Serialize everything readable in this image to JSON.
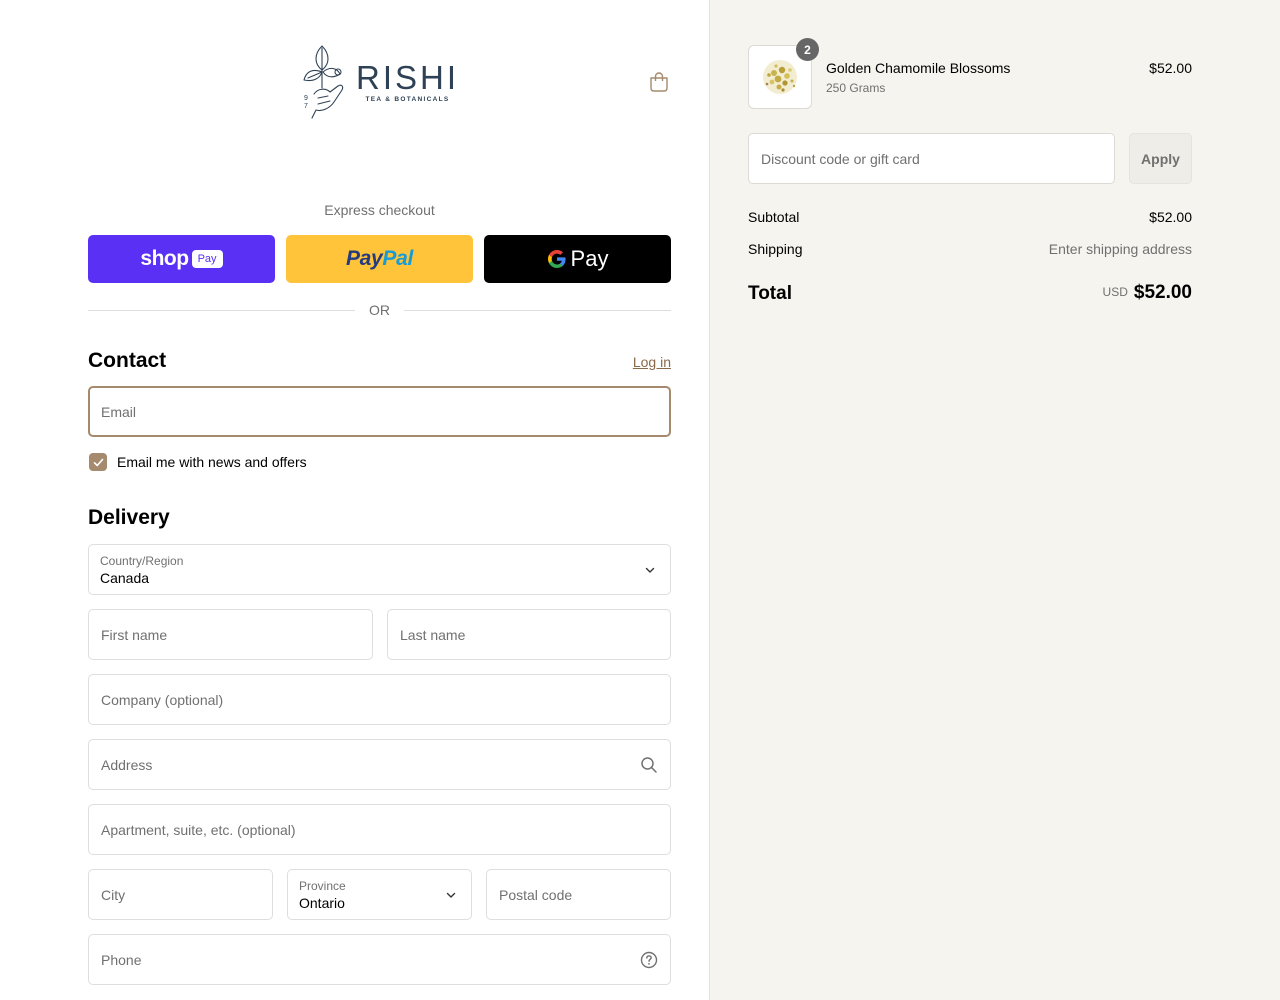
{
  "brand": {
    "name": "RISHI",
    "tagline": "TEA & BOTANICALS",
    "year_digits": "97"
  },
  "express": {
    "title": "Express checkout",
    "shop_pay": {
      "word": "shop",
      "badge": "Pay"
    },
    "paypal": {
      "part1": "Pay",
      "part2": "Pal"
    },
    "google_pay": {
      "word": "Pay"
    },
    "or_label": "OR"
  },
  "contact": {
    "heading": "Contact",
    "login_label": "Log in",
    "email_placeholder": "Email",
    "newsletter_label": "Email me with news and offers",
    "newsletter_checked": true
  },
  "delivery": {
    "heading": "Delivery",
    "country_label": "Country/Region",
    "country_value": "Canada",
    "first_name_placeholder": "First name",
    "last_name_placeholder": "Last name",
    "company_placeholder": "Company (optional)",
    "address_placeholder": "Address",
    "apartment_placeholder": "Apartment, suite, etc. (optional)",
    "city_placeholder": "City",
    "province_label": "Province",
    "province_value": "Ontario",
    "postal_placeholder": "Postal code",
    "phone_placeholder": "Phone"
  },
  "summary": {
    "item": {
      "name": "Golden Chamomile Blossoms",
      "variant": "250 Grams",
      "price": "$52.00",
      "quantity": "2"
    },
    "discount_placeholder": "Discount code or gift card",
    "apply_label": "Apply",
    "subtotal_label": "Subtotal",
    "subtotal_value": "$52.00",
    "shipping_label": "Shipping",
    "shipping_value": "Enter shipping address",
    "total_label": "Total",
    "currency": "USD",
    "total_value": "$52.00"
  },
  "colors": {
    "accent": "#a58a6d",
    "shop_pay": "#5a31f4",
    "paypal": "#ffc439",
    "summary_bg": "#f5f4ef"
  }
}
